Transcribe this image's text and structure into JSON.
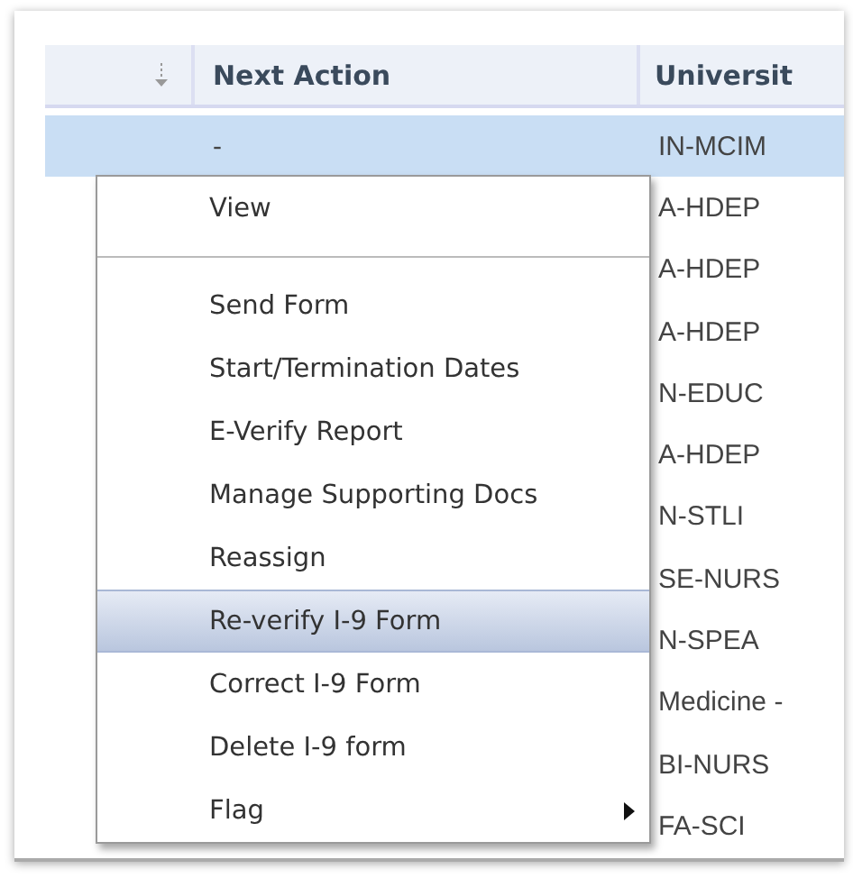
{
  "table": {
    "columns": [
      {
        "kind": "sort_icon"
      },
      {
        "kind": "text",
        "label": "Next Action"
      },
      {
        "kind": "text",
        "label": "Universit"
      }
    ],
    "rows": [
      {
        "next_action": "-",
        "university": "IN-MCIM",
        "selected": true
      },
      {
        "university": "A-HDEP",
        "selected": false
      },
      {
        "university": "A-HDEP",
        "selected": false
      },
      {
        "university": "A-HDEP",
        "selected": false
      },
      {
        "university": "N-EDUC",
        "selected": false
      },
      {
        "university": "A-HDEP",
        "selected": false
      },
      {
        "university": "N-STLI",
        "selected": false
      },
      {
        "university": "SE-NURS",
        "selected": false
      },
      {
        "university": "N-SPEA",
        "selected": false
      },
      {
        "university": "Medicine -",
        "selected": false
      },
      {
        "university": "BI-NURS",
        "selected": false
      },
      {
        "university": "FA-SCI",
        "selected": false
      }
    ]
  },
  "context_menu": {
    "groups": [
      [
        {
          "label": "View",
          "selected": false,
          "has_submenu": false
        }
      ],
      [
        {
          "label": "Send Form",
          "selected": false,
          "has_submenu": false
        },
        {
          "label": "Start/Termination Dates",
          "selected": false,
          "has_submenu": false
        },
        {
          "label": "E-Verify Report",
          "selected": false,
          "has_submenu": false
        },
        {
          "label": "Manage Supporting Docs",
          "selected": false,
          "has_submenu": false
        },
        {
          "label": "Reassign",
          "selected": false,
          "has_submenu": false
        },
        {
          "label": "Re-verify I-9 Form",
          "selected": true,
          "has_submenu": false
        },
        {
          "label": "Correct I-9 Form",
          "selected": false,
          "has_submenu": false
        },
        {
          "label": "Delete I-9 form",
          "selected": false,
          "has_submenu": false
        },
        {
          "label": "Flag",
          "selected": false,
          "has_submenu": true
        }
      ]
    ]
  }
}
